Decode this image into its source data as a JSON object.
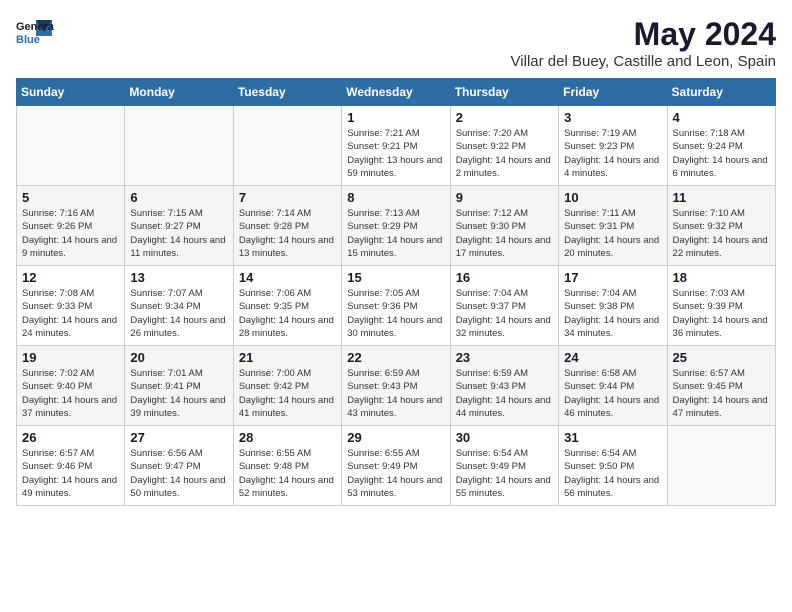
{
  "header": {
    "logo_general": "General",
    "logo_blue": "Blue",
    "month_title": "May 2024",
    "location": "Villar del Buey, Castille and Leon, Spain"
  },
  "weekdays": [
    "Sunday",
    "Monday",
    "Tuesday",
    "Wednesday",
    "Thursday",
    "Friday",
    "Saturday"
  ],
  "weeks": [
    [
      {
        "day": "",
        "sunrise": "",
        "sunset": "",
        "daylight": ""
      },
      {
        "day": "",
        "sunrise": "",
        "sunset": "",
        "daylight": ""
      },
      {
        "day": "",
        "sunrise": "",
        "sunset": "",
        "daylight": ""
      },
      {
        "day": "1",
        "sunrise": "Sunrise: 7:21 AM",
        "sunset": "Sunset: 9:21 PM",
        "daylight": "Daylight: 13 hours and 59 minutes."
      },
      {
        "day": "2",
        "sunrise": "Sunrise: 7:20 AM",
        "sunset": "Sunset: 9:22 PM",
        "daylight": "Daylight: 14 hours and 2 minutes."
      },
      {
        "day": "3",
        "sunrise": "Sunrise: 7:19 AM",
        "sunset": "Sunset: 9:23 PM",
        "daylight": "Daylight: 14 hours and 4 minutes."
      },
      {
        "day": "4",
        "sunrise": "Sunrise: 7:18 AM",
        "sunset": "Sunset: 9:24 PM",
        "daylight": "Daylight: 14 hours and 6 minutes."
      }
    ],
    [
      {
        "day": "5",
        "sunrise": "Sunrise: 7:16 AM",
        "sunset": "Sunset: 9:26 PM",
        "daylight": "Daylight: 14 hours and 9 minutes."
      },
      {
        "day": "6",
        "sunrise": "Sunrise: 7:15 AM",
        "sunset": "Sunset: 9:27 PM",
        "daylight": "Daylight: 14 hours and 11 minutes."
      },
      {
        "day": "7",
        "sunrise": "Sunrise: 7:14 AM",
        "sunset": "Sunset: 9:28 PM",
        "daylight": "Daylight: 14 hours and 13 minutes."
      },
      {
        "day": "8",
        "sunrise": "Sunrise: 7:13 AM",
        "sunset": "Sunset: 9:29 PM",
        "daylight": "Daylight: 14 hours and 15 minutes."
      },
      {
        "day": "9",
        "sunrise": "Sunrise: 7:12 AM",
        "sunset": "Sunset: 9:30 PM",
        "daylight": "Daylight: 14 hours and 17 minutes."
      },
      {
        "day": "10",
        "sunrise": "Sunrise: 7:11 AM",
        "sunset": "Sunset: 9:31 PM",
        "daylight": "Daylight: 14 hours and 20 minutes."
      },
      {
        "day": "11",
        "sunrise": "Sunrise: 7:10 AM",
        "sunset": "Sunset: 9:32 PM",
        "daylight": "Daylight: 14 hours and 22 minutes."
      }
    ],
    [
      {
        "day": "12",
        "sunrise": "Sunrise: 7:08 AM",
        "sunset": "Sunset: 9:33 PM",
        "daylight": "Daylight: 14 hours and 24 minutes."
      },
      {
        "day": "13",
        "sunrise": "Sunrise: 7:07 AM",
        "sunset": "Sunset: 9:34 PM",
        "daylight": "Daylight: 14 hours and 26 minutes."
      },
      {
        "day": "14",
        "sunrise": "Sunrise: 7:06 AM",
        "sunset": "Sunset: 9:35 PM",
        "daylight": "Daylight: 14 hours and 28 minutes."
      },
      {
        "day": "15",
        "sunrise": "Sunrise: 7:05 AM",
        "sunset": "Sunset: 9:36 PM",
        "daylight": "Daylight: 14 hours and 30 minutes."
      },
      {
        "day": "16",
        "sunrise": "Sunrise: 7:04 AM",
        "sunset": "Sunset: 9:37 PM",
        "daylight": "Daylight: 14 hours and 32 minutes."
      },
      {
        "day": "17",
        "sunrise": "Sunrise: 7:04 AM",
        "sunset": "Sunset: 9:38 PM",
        "daylight": "Daylight: 14 hours and 34 minutes."
      },
      {
        "day": "18",
        "sunrise": "Sunrise: 7:03 AM",
        "sunset": "Sunset: 9:39 PM",
        "daylight": "Daylight: 14 hours and 36 minutes."
      }
    ],
    [
      {
        "day": "19",
        "sunrise": "Sunrise: 7:02 AM",
        "sunset": "Sunset: 9:40 PM",
        "daylight": "Daylight: 14 hours and 37 minutes."
      },
      {
        "day": "20",
        "sunrise": "Sunrise: 7:01 AM",
        "sunset": "Sunset: 9:41 PM",
        "daylight": "Daylight: 14 hours and 39 minutes."
      },
      {
        "day": "21",
        "sunrise": "Sunrise: 7:00 AM",
        "sunset": "Sunset: 9:42 PM",
        "daylight": "Daylight: 14 hours and 41 minutes."
      },
      {
        "day": "22",
        "sunrise": "Sunrise: 6:59 AM",
        "sunset": "Sunset: 9:43 PM",
        "daylight": "Daylight: 14 hours and 43 minutes."
      },
      {
        "day": "23",
        "sunrise": "Sunrise: 6:59 AM",
        "sunset": "Sunset: 9:43 PM",
        "daylight": "Daylight: 14 hours and 44 minutes."
      },
      {
        "day": "24",
        "sunrise": "Sunrise: 6:58 AM",
        "sunset": "Sunset: 9:44 PM",
        "daylight": "Daylight: 14 hours and 46 minutes."
      },
      {
        "day": "25",
        "sunrise": "Sunrise: 6:57 AM",
        "sunset": "Sunset: 9:45 PM",
        "daylight": "Daylight: 14 hours and 47 minutes."
      }
    ],
    [
      {
        "day": "26",
        "sunrise": "Sunrise: 6:57 AM",
        "sunset": "Sunset: 9:46 PM",
        "daylight": "Daylight: 14 hours and 49 minutes."
      },
      {
        "day": "27",
        "sunrise": "Sunrise: 6:56 AM",
        "sunset": "Sunset: 9:47 PM",
        "daylight": "Daylight: 14 hours and 50 minutes."
      },
      {
        "day": "28",
        "sunrise": "Sunrise: 6:55 AM",
        "sunset": "Sunset: 9:48 PM",
        "daylight": "Daylight: 14 hours and 52 minutes."
      },
      {
        "day": "29",
        "sunrise": "Sunrise: 6:55 AM",
        "sunset": "Sunset: 9:49 PM",
        "daylight": "Daylight: 14 hours and 53 minutes."
      },
      {
        "day": "30",
        "sunrise": "Sunrise: 6:54 AM",
        "sunset": "Sunset: 9:49 PM",
        "daylight": "Daylight: 14 hours and 55 minutes."
      },
      {
        "day": "31",
        "sunrise": "Sunrise: 6:54 AM",
        "sunset": "Sunset: 9:50 PM",
        "daylight": "Daylight: 14 hours and 56 minutes."
      },
      {
        "day": "",
        "sunrise": "",
        "sunset": "",
        "daylight": ""
      }
    ]
  ]
}
